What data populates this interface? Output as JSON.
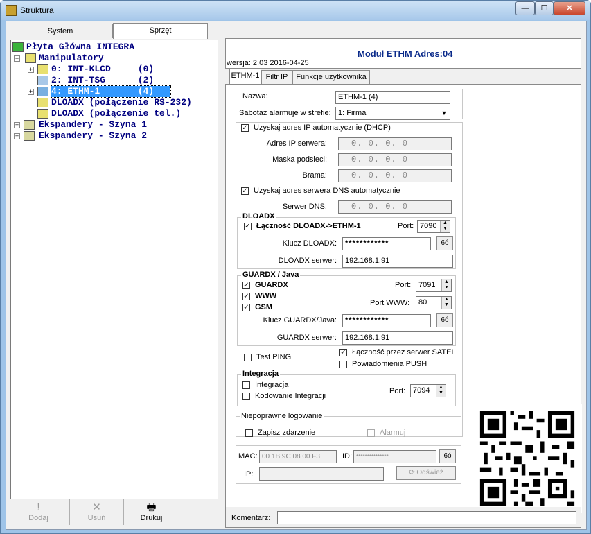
{
  "window": {
    "title": "Struktura",
    "min": "—",
    "max": "☐",
    "close": "✕"
  },
  "left_tabs": [
    {
      "label": "System"
    },
    {
      "label": "Sprzęt"
    }
  ],
  "tree": {
    "root": "Płyta Główna INTEGRA",
    "manipulatory": "Manipulatory",
    "items": [
      {
        "label": "0: INT-KLCD     (0)"
      },
      {
        "label": "2: INT-TSG      (2)"
      },
      {
        "label": "4: ETHM-1       (4)"
      }
    ],
    "dloadx1": "DLOADX (połączenie RS-232)",
    "dloadx2": "DLOADX (połączenie tel.)",
    "exp1": "Ekspandery - Szyna 1",
    "exp2": "Ekspandery - Szyna 2"
  },
  "toolbar": {
    "add": "Dodaj",
    "remove": "Usuń",
    "print": "Drukuj"
  },
  "header": {
    "module_title": "Moduł ETHM Adres:04",
    "version": "wersja: 2.03 2016-04-25"
  },
  "right_tabs": [
    {
      "label": "ETHM-1"
    },
    {
      "label": "Filtr IP"
    },
    {
      "label": "Funkcje użytkownika"
    }
  ],
  "form": {
    "name_label": "Nazwa:",
    "name_value": "ETHM-1     (4)",
    "tamper_label": "Sabotaż alarmuje w strefie:",
    "tamper_value": "1: Firma",
    "dhcp_label": "Uzyskaj adres IP automatycznie (DHCP)",
    "ip_label": "Adres IP serwera:",
    "ip_value": "0.  0.  0.  0",
    "mask_label": "Maska podsieci:",
    "mask_value": "0.  0.  0.  0",
    "gate_label": "Brama:",
    "gate_value": "0.  0.  0.  0",
    "dns_auto_label": "Uzyskaj adres serwera DNS automatycznie",
    "dns_label": "Serwer DNS:",
    "dns_value": "0.  0.  0.  0",
    "dloadx_title": "DLOADX",
    "dloadx_conn_label": "Łączność DLOADX->ETHM-1",
    "port_label": "Port:",
    "dloadx_port": "7090",
    "dloadx_key_label": "Klucz DLOADX:",
    "dloadx_key": "************",
    "dloadx_server_label": "DLOADX serwer:",
    "dloadx_server": "192.168.1.91",
    "guardx_title": "GUARDX / Java",
    "guardx_label": "GUARDX",
    "www_label": "WWW",
    "gsm_label": "GSM",
    "guardx_port": "7091",
    "port_www_label": "Port WWW:",
    "www_port": "80",
    "guardx_key_label": "Klucz GUARDX/Java:",
    "guardx_key": "************",
    "guardx_server_label": "GUARDX serwer:",
    "guardx_server": "192.168.1.91",
    "test_ping": "Test PING",
    "satel_label": "Łączność przez serwer SATEL",
    "push_label": "Powiadomienia PUSH",
    "integ_title": "Integracja",
    "integ_label": "Integracja",
    "integ_coding": "Kodowanie Integracji",
    "integ_port": "7094",
    "badlog_title": "Niepoprawne logowanie",
    "log_event": "Zapisz zdarzenie",
    "alarm": "Alarmuj",
    "mac_label": "MAC:",
    "mac_value": "00 1B 9C 08 00 F3",
    "id_label": "ID:",
    "id_value": "***************",
    "ip2_label": "IP:",
    "refresh": "Odśwież",
    "eye": "6ó"
  },
  "comment_label": "Komentarz:"
}
